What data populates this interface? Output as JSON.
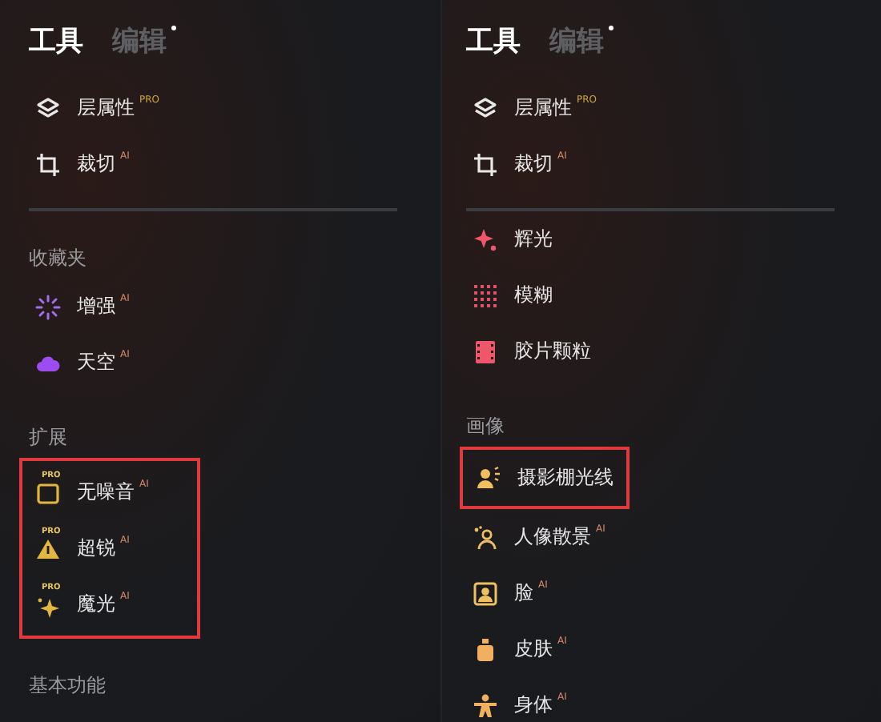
{
  "panels": [
    {
      "tabs": [
        {
          "label": "工具",
          "selected": true,
          "dot": false
        },
        {
          "label": "编辑",
          "selected": false,
          "dot": true
        }
      ],
      "sections": [
        {
          "items": [
            {
              "label": "层属性",
              "badge": "PRO",
              "highlighted": false
            },
            {
              "label": "裁切",
              "badge": "AI",
              "highlighted": false
            }
          ]
        },
        {
          "title": "收藏夹",
          "items": [
            {
              "label": "增强",
              "badge": "AI",
              "highlighted": false
            },
            {
              "label": "天空",
              "badge": "AI",
              "highlighted": false
            }
          ]
        },
        {
          "title": "扩展",
          "items": [
            {
              "label": "无噪音",
              "badge": "AI",
              "icon_badge": "PRO",
              "highlighted": true
            },
            {
              "label": "超锐",
              "badge": "AI",
              "icon_badge": "PRO",
              "highlighted": true
            },
            {
              "label": "魔光",
              "badge": "AI",
              "icon_badge": "PRO",
              "highlighted": true
            }
          ]
        },
        {
          "title": "基本功能"
        }
      ]
    },
    {
      "tabs": [
        {
          "label": "工具",
          "selected": true,
          "dot": false
        },
        {
          "label": "编辑",
          "selected": false,
          "dot": true
        }
      ],
      "sections": [
        {
          "items": [
            {
              "label": "层属性",
              "badge": "PRO",
              "highlighted": false
            },
            {
              "label": "裁切",
              "badge": "AI",
              "highlighted": false
            }
          ]
        },
        {
          "items": [
            {
              "label": "辉光",
              "highlighted": false
            },
            {
              "label": "模糊",
              "highlighted": false
            },
            {
              "label": "胶片颗粒",
              "highlighted": false
            }
          ]
        },
        {
          "title": "画像",
          "items": [
            {
              "label": "摄影棚光线",
              "highlighted": true
            },
            {
              "label": "人像散景",
              "badge": "AI",
              "highlighted": false
            },
            {
              "label": "脸",
              "badge": "AI",
              "highlighted": false
            },
            {
              "label": "皮肤",
              "badge": "AI",
              "highlighted": false
            },
            {
              "label": "身体",
              "badge": "AI",
              "highlighted": false
            }
          ]
        }
      ]
    }
  ]
}
